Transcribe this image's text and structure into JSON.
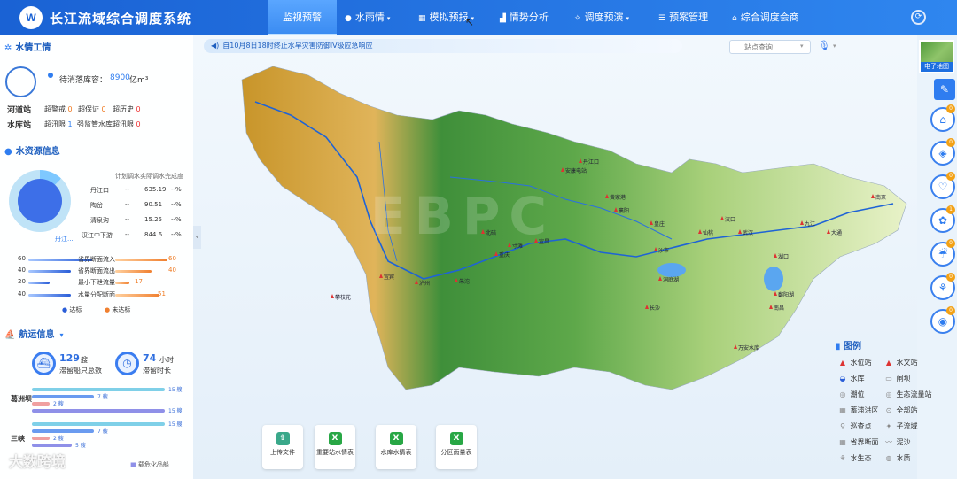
{
  "header": {
    "logo_text": "W",
    "title": "长江流域综合调度系统",
    "nav": [
      {
        "label": "监视预警",
        "icon": "",
        "active": true
      },
      {
        "label": "水雨情",
        "icon": "drop-icon",
        "glyph": "●",
        "chevron": true
      },
      {
        "label": "模拟预报",
        "icon": "grid-icon",
        "glyph": "▦",
        "chevron": true
      },
      {
        "label": "情势分析",
        "icon": "chart-icon",
        "glyph": "▟"
      },
      {
        "label": "调度预演",
        "icon": "tools-icon",
        "glyph": "✧",
        "chevron": true
      },
      {
        "label": "预案管理",
        "icon": "list-icon",
        "glyph": "☰"
      },
      {
        "label": "综合调度会商",
        "icon": "home-icon",
        "glyph": "⌂"
      }
    ]
  },
  "left_panel": {
    "water_rain": {
      "title": "水情工情",
      "reservoir_label": "待消落库容：",
      "reservoir_value": "8900",
      "reservoir_unit": "亿m³",
      "river_label": "河道站",
      "river_items": [
        {
          "label": "超警戒",
          "value": "0"
        },
        {
          "label": "超保证",
          "value": "0"
        },
        {
          "label": "超历史",
          "value": "0"
        }
      ],
      "res_label": "水库站",
      "res_items": [
        {
          "label": "超汛限",
          "value": "1"
        },
        {
          "label": "强监管水库超汛限",
          "value": "0"
        }
      ]
    },
    "water_resource": {
      "title": "水资源信息",
      "table_header": "计划调水实际调水完成度",
      "donut_label": "丹江...",
      "donut_fraction": 0.12,
      "rows": [
        {
          "name": "丹江口",
          "plan": "--",
          "actual": "635.19",
          "rate": "--%"
        },
        {
          "name": "陶岔",
          "plan": "--",
          "actual": "90.51",
          "rate": "--%"
        },
        {
          "name": "清泉沟",
          "plan": "--",
          "actual": "15.25",
          "rate": "--%"
        },
        {
          "name": "汉江中下游",
          "plan": "--",
          "actual": "844.6",
          "rate": "--%"
        }
      ],
      "bars": [
        {
          "label": "省界断面流入",
          "left": "60",
          "right": "60"
        },
        {
          "label": "省界断面流出",
          "left": "40",
          "right": "40"
        },
        {
          "label": "最小下泄流量",
          "left": "20",
          "right": "17"
        },
        {
          "label": "水量分配断面",
          "left": "40",
          "right": "51"
        }
      ],
      "legend_ok": "达标",
      "legend_bad": "未达标"
    },
    "shipping": {
      "title": "航运信息",
      "ships_value": "129",
      "ships_unit": "艘",
      "ships_label": "滞留船只总数",
      "hours_value": "74",
      "hours_unit": "小时",
      "hours_label": "滞留时长",
      "loc1": "葛洲坝",
      "loc1_vals": [
        "15 艘",
        "7 艘",
        "2 艘",
        "15 艘"
      ],
      "loc2": "三峡",
      "loc2_vals": [
        "15 艘",
        "7 艘",
        "2 艘",
        "5 艘"
      ],
      "legend_last": "载危化品船"
    }
  },
  "map": {
    "notice": "自10月8日18时终止水旱灾害防御IV级应急响应",
    "search_placeholder": "站点查询",
    "thumb_label": "电子地图",
    "labels": [
      "安康电站",
      "丹江口",
      "黄家港",
      "襄阳",
      "皇庄",
      "沙市",
      "仙桃",
      "汉口",
      "武汉",
      "九江",
      "湖口",
      "大通",
      "南京",
      "鄱阳湖",
      "洞庭湖",
      "万安水库",
      "宜昌",
      "北碚",
      "重庆",
      "寸滩",
      "朱沱",
      "泸州",
      "宜宾",
      "攀枝花",
      "长沙",
      "南昌"
    ]
  },
  "right_rail": {
    "badges": [
      "0",
      "0",
      "0",
      "1",
      "0",
      "0",
      "0"
    ]
  },
  "legend": {
    "title": "图例",
    "items": [
      {
        "label": "水位站",
        "icon": "water-level-station-icon",
        "glyph": "▲"
      },
      {
        "label": "水文站",
        "icon": "hydro-station-icon",
        "glyph": "▲"
      },
      {
        "label": "水库",
        "icon": "reservoir-icon",
        "glyph": "◒"
      },
      {
        "label": "闸坝",
        "icon": "gate-icon",
        "glyph": "▭"
      },
      {
        "label": "潮位",
        "icon": "tide-icon",
        "glyph": "◎"
      },
      {
        "label": "生态流量站",
        "icon": "eco-flow-icon",
        "glyph": "◎"
      },
      {
        "label": "蓄滞洪区",
        "icon": "flood-area-icon",
        "glyph": "▦"
      },
      {
        "label": "全部站",
        "icon": "all-station-icon",
        "glyph": "⊙"
      },
      {
        "label": "巡查点",
        "icon": "patrol-icon",
        "glyph": "⚲"
      },
      {
        "label": "子流域",
        "icon": "sub-basin-icon",
        "glyph": "✦"
      },
      {
        "label": "省界断面",
        "icon": "boundary-icon",
        "glyph": "▦"
      },
      {
        "label": "泥沙",
        "icon": "sediment-icon",
        "glyph": "〰"
      },
      {
        "label": "水生态",
        "icon": "eco-icon",
        "glyph": "⚘"
      },
      {
        "label": "水质",
        "icon": "quality-icon",
        "glyph": "◍"
      }
    ]
  },
  "tiles": [
    {
      "label": "上传文件",
      "glyph": "⇧",
      "icon": "upload-icon"
    },
    {
      "label": "重要站水情表",
      "glyph": "X",
      "icon": "excel-icon"
    },
    {
      "label": "水库水情表",
      "glyph": "X",
      "icon": "excel-icon"
    },
    {
      "label": "分区雨量表",
      "glyph": "X",
      "icon": "excel-icon"
    }
  ],
  "watermark": "大数跨境",
  "colors": {
    "brand": "#1a62d4",
    "accent": "#2f7df0",
    "warn": "#ef7a22",
    "badge": "#f3a114"
  }
}
